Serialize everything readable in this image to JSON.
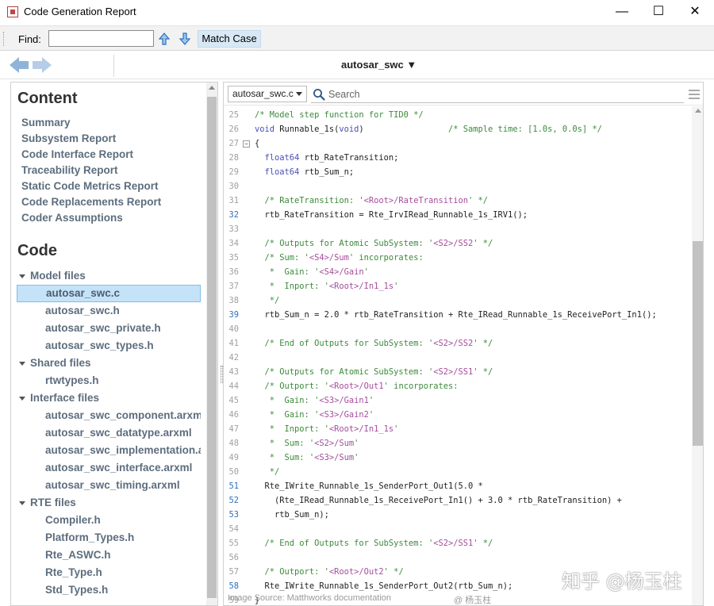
{
  "window": {
    "title": "Code Generation Report",
    "minimize": "—",
    "maximize": "☐",
    "close": "✕"
  },
  "findbar": {
    "label": "Find:",
    "value": "",
    "match_case_label": "Match Case"
  },
  "nav": {
    "project": "autosar_swc ▼"
  },
  "sidebar": {
    "content_heading": "Content",
    "reports": [
      "Summary",
      "Subsystem Report",
      "Code Interface Report",
      "Traceability Report",
      "Static Code Metrics Report",
      "Code Replacements Report",
      "Coder Assumptions"
    ],
    "code_heading": "Code",
    "groups": [
      {
        "label": "Model files",
        "files": [
          "autosar_swc.c",
          "autosar_swc.h",
          "autosar_swc_private.h",
          "autosar_swc_types.h"
        ]
      },
      {
        "label": "Shared files",
        "files": [
          "rtwtypes.h"
        ]
      },
      {
        "label": "Interface files",
        "files": [
          "autosar_swc_component.arxml",
          "autosar_swc_datatype.arxml",
          "autosar_swc_implementation.arxml",
          "autosar_swc_interface.arxml",
          "autosar_swc_timing.arxml"
        ]
      },
      {
        "label": "RTE files",
        "files": [
          "Compiler.h",
          "Platform_Types.h",
          "Rte_ASWC.h",
          "Rte_Type.h",
          "Std_Types.h"
        ]
      }
    ],
    "selected_file": "autosar_swc.c"
  },
  "code_view": {
    "file_select": "autosar_swc.c",
    "search_placeholder": "Search",
    "lines": [
      {
        "n": "25",
        "linked": false,
        "spans": [
          [
            "cm",
            "/* Model step function for TID0 */"
          ]
        ]
      },
      {
        "n": "26",
        "linked": false,
        "spans": [
          [
            "kw",
            "void"
          ],
          [
            "pl",
            " Runnable_1s("
          ],
          [
            "kw",
            "void"
          ],
          [
            "pl",
            ")                 "
          ],
          [
            "cm",
            "/* Sample time: [1.0s, 0.0s] */"
          ]
        ]
      },
      {
        "n": "27",
        "linked": false,
        "fold": "−",
        "spans": [
          [
            "pl",
            "{"
          ]
        ]
      },
      {
        "n": "28",
        "linked": false,
        "spans": [
          [
            "kw",
            "  float64"
          ],
          [
            "pl",
            " rtb_RateTransition;"
          ]
        ]
      },
      {
        "n": "29",
        "linked": false,
        "spans": [
          [
            "kw",
            "  float64"
          ],
          [
            "pl",
            " rtb_Sum_n;"
          ]
        ]
      },
      {
        "n": "30",
        "linked": false,
        "spans": []
      },
      {
        "n": "31",
        "linked": false,
        "spans": [
          [
            "cm",
            "  /* RateTransition: '"
          ],
          [
            "st",
            "<Root>/RateTransition"
          ],
          [
            "cm",
            "' */"
          ]
        ]
      },
      {
        "n": "32",
        "linked": true,
        "spans": [
          [
            "pl",
            "  rtb_RateTransition = Rte_IrvIRead_Runnable_1s_IRV1();"
          ]
        ]
      },
      {
        "n": "33",
        "linked": false,
        "spans": []
      },
      {
        "n": "34",
        "linked": false,
        "spans": [
          [
            "cm",
            "  /* Outputs for Atomic SubSystem: '"
          ],
          [
            "st",
            "<S2>/SS2"
          ],
          [
            "cm",
            "' */"
          ]
        ]
      },
      {
        "n": "35",
        "linked": false,
        "spans": [
          [
            "cm",
            "  /* Sum: '"
          ],
          [
            "st",
            "<S4>/Sum"
          ],
          [
            "cm",
            "' incorporates:"
          ]
        ]
      },
      {
        "n": "36",
        "linked": false,
        "spans": [
          [
            "cm",
            "   *  Gain: '"
          ],
          [
            "st",
            "<S4>/Gain"
          ],
          [
            "cm",
            "'"
          ]
        ]
      },
      {
        "n": "37",
        "linked": false,
        "spans": [
          [
            "cm",
            "   *  Inport: '"
          ],
          [
            "st",
            "<Root>/In1_1s"
          ],
          [
            "cm",
            "'"
          ]
        ]
      },
      {
        "n": "38",
        "linked": false,
        "spans": [
          [
            "cm",
            "   */"
          ]
        ]
      },
      {
        "n": "39",
        "linked": true,
        "spans": [
          [
            "pl",
            "  rtb_Sum_n = 2.0 * rtb_RateTransition + Rte_IRead_Runnable_1s_ReceivePort_In1();"
          ]
        ]
      },
      {
        "n": "40",
        "linked": false,
        "spans": []
      },
      {
        "n": "41",
        "linked": false,
        "spans": [
          [
            "cm",
            "  /* End of Outputs for SubSystem: '"
          ],
          [
            "st",
            "<S2>/SS2"
          ],
          [
            "cm",
            "' */"
          ]
        ]
      },
      {
        "n": "42",
        "linked": false,
        "spans": []
      },
      {
        "n": "43",
        "linked": false,
        "spans": [
          [
            "cm",
            "  /* Outputs for Atomic SubSystem: '"
          ],
          [
            "st",
            "<S2>/SS1"
          ],
          [
            "cm",
            "' */"
          ]
        ]
      },
      {
        "n": "44",
        "linked": false,
        "spans": [
          [
            "cm",
            "  /* Outport: '"
          ],
          [
            "st",
            "<Root>/Out1"
          ],
          [
            "cm",
            "' incorporates:"
          ]
        ]
      },
      {
        "n": "45",
        "linked": false,
        "spans": [
          [
            "cm",
            "   *  Gain: '"
          ],
          [
            "st",
            "<S3>/Gain1"
          ],
          [
            "cm",
            "'"
          ]
        ]
      },
      {
        "n": "46",
        "linked": false,
        "spans": [
          [
            "cm",
            "   *  Gain: '"
          ],
          [
            "st",
            "<S3>/Gain2"
          ],
          [
            "cm",
            "'"
          ]
        ]
      },
      {
        "n": "47",
        "linked": false,
        "spans": [
          [
            "cm",
            "   *  Inport: '"
          ],
          [
            "st",
            "<Root>/In1_1s"
          ],
          [
            "cm",
            "'"
          ]
        ]
      },
      {
        "n": "48",
        "linked": false,
        "spans": [
          [
            "cm",
            "   *  Sum: '"
          ],
          [
            "st",
            "<S2>/Sum"
          ],
          [
            "cm",
            "'"
          ]
        ]
      },
      {
        "n": "49",
        "linked": false,
        "spans": [
          [
            "cm",
            "   *  Sum: '"
          ],
          [
            "st",
            "<S3>/Sum"
          ],
          [
            "cm",
            "'"
          ]
        ]
      },
      {
        "n": "50",
        "linked": false,
        "spans": [
          [
            "cm",
            "   */"
          ]
        ]
      },
      {
        "n": "51",
        "linked": true,
        "spans": [
          [
            "pl",
            "  Rte_IWrite_Runnable_1s_SenderPort_Out1(5.0 *"
          ]
        ]
      },
      {
        "n": "52",
        "linked": true,
        "spans": [
          [
            "pl",
            "    (Rte_IRead_Runnable_1s_ReceivePort_In1() + 3.0 * rtb_RateTransition) +"
          ]
        ]
      },
      {
        "n": "53",
        "linked": true,
        "spans": [
          [
            "pl",
            "    rtb_Sum_n);"
          ]
        ]
      },
      {
        "n": "54",
        "linked": false,
        "spans": []
      },
      {
        "n": "55",
        "linked": false,
        "spans": [
          [
            "cm",
            "  /* End of Outputs for SubSystem: '"
          ],
          [
            "st",
            "<S2>/SS1"
          ],
          [
            "cm",
            "' */"
          ]
        ]
      },
      {
        "n": "56",
        "linked": false,
        "spans": []
      },
      {
        "n": "57",
        "linked": false,
        "spans": [
          [
            "cm",
            "  /* Outport: '"
          ],
          [
            "st",
            "<Root>/Out2"
          ],
          [
            "cm",
            "' */"
          ]
        ]
      },
      {
        "n": "58",
        "linked": true,
        "spans": [
          [
            "pl",
            "  Rte_IWrite_Runnable_1s_SenderPort_Out2(rtb_Sum_n);"
          ]
        ]
      },
      {
        "n": "59",
        "linked": false,
        "spans": [
          [
            "pl",
            "}"
          ]
        ]
      }
    ]
  },
  "watermarks": {
    "source": "Image Source:  Matthworks documentation",
    "author": "@ 杨玉柱",
    "zhihu": "知乎 @杨玉柱"
  },
  "colors": {
    "selected_bg": "#c5e3f8",
    "link_text": "#5d6d7e",
    "comment": "#3c8a3c",
    "keyword": "#4a50b4",
    "string_ref": "#a54d9c",
    "line_link": "#2f6fbf"
  }
}
